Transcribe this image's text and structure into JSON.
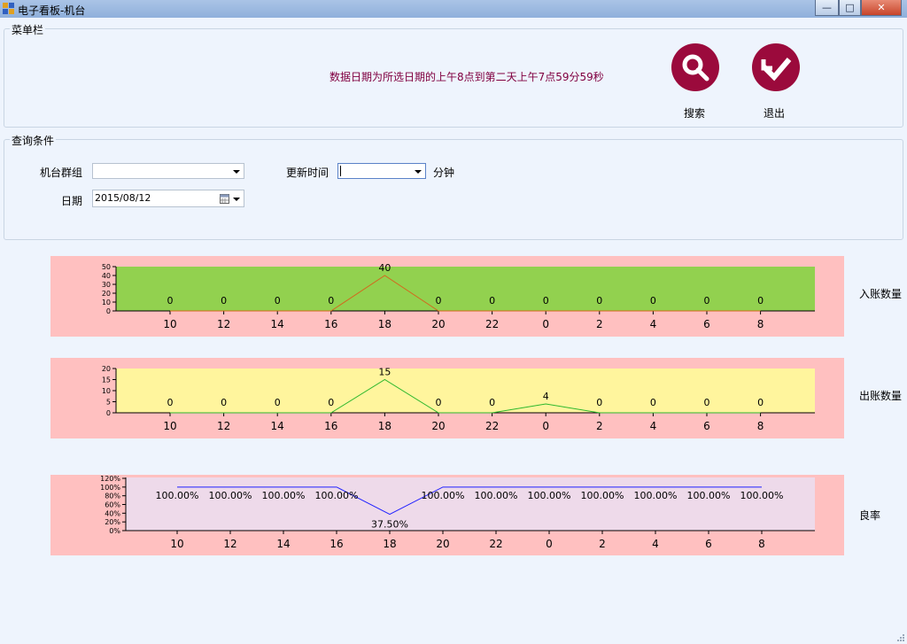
{
  "window": {
    "title": "电子看板-机台",
    "buttons": {
      "minimize": "—",
      "maximize": "□",
      "close": "✕"
    }
  },
  "menu": {
    "legend": "菜单栏",
    "notice": "数据日期为所选日期的上午8点到第二天上午7点59分59秒",
    "search_label": "搜索",
    "exit_label": "退出",
    "search_icon": "magnifier-icon",
    "exit_icon": "check-arrow-icon",
    "accent": "#9b0a3c"
  },
  "query": {
    "legend": "查询条件",
    "group_label": "机台群组",
    "group_value": "",
    "refresh_label": "更新时间",
    "refresh_value": "",
    "refresh_unit": "分钟",
    "date_label": "日期",
    "date_value": "2015/08/12"
  },
  "chart_data": [
    {
      "type": "line",
      "name_label": "入账数量",
      "categories": [
        "10",
        "12",
        "14",
        "16",
        "18",
        "20",
        "22",
        "0",
        "2",
        "4",
        "6",
        "8"
      ],
      "values": [
        0,
        0,
        0,
        0,
        40,
        0,
        0,
        0,
        0,
        0,
        0,
        0
      ],
      "value_labels": [
        "0",
        "0",
        "0",
        "0",
        "40",
        "0",
        "0",
        "0",
        "0",
        "0",
        "0",
        "0"
      ],
      "ylim": [
        0,
        50
      ],
      "yticks": [
        "0",
        "10",
        "20",
        "30",
        "40",
        "50"
      ],
      "plot_color": "#92d14f",
      "line_color": "#d2691e",
      "outer_color": "#ffc0c0"
    },
    {
      "type": "line",
      "name_label": "出账数量",
      "categories": [
        "10",
        "12",
        "14",
        "16",
        "18",
        "20",
        "22",
        "0",
        "2",
        "4",
        "6",
        "8"
      ],
      "values": [
        0,
        0,
        0,
        0,
        15,
        0,
        0,
        4,
        0,
        0,
        0,
        0
      ],
      "value_labels": [
        "0",
        "0",
        "0",
        "0",
        "15",
        "0",
        "0",
        "4",
        "0",
        "0",
        "0",
        "0"
      ],
      "ylim": [
        0,
        20
      ],
      "yticks": [
        "0",
        "5",
        "10",
        "15",
        "20"
      ],
      "plot_color": "#fff59d",
      "line_color": "#2db82d",
      "outer_color": "#ffc0c0"
    },
    {
      "type": "line",
      "name_label": "良率",
      "categories": [
        "10",
        "12",
        "14",
        "16",
        "18",
        "20",
        "22",
        "0",
        "2",
        "4",
        "6",
        "8"
      ],
      "values": [
        100,
        100,
        100,
        100,
        37.5,
        100,
        100,
        100,
        100,
        100,
        100,
        100
      ],
      "value_labels": [
        "100.00%",
        "100.00%",
        "100.00%",
        "100.00%",
        "37.50%",
        "100.00%",
        "100.00%",
        "100.00%",
        "100.00%",
        "100.00%",
        "100.00%",
        "100.00%"
      ],
      "ylim": [
        0,
        120
      ],
      "yticks": [
        "0%",
        "20%",
        "40%",
        "60%",
        "80%",
        "100%",
        "120%"
      ],
      "plot_color": "#eedaea",
      "line_color": "#2020ff",
      "outer_color": "#ffc0c0"
    }
  ]
}
